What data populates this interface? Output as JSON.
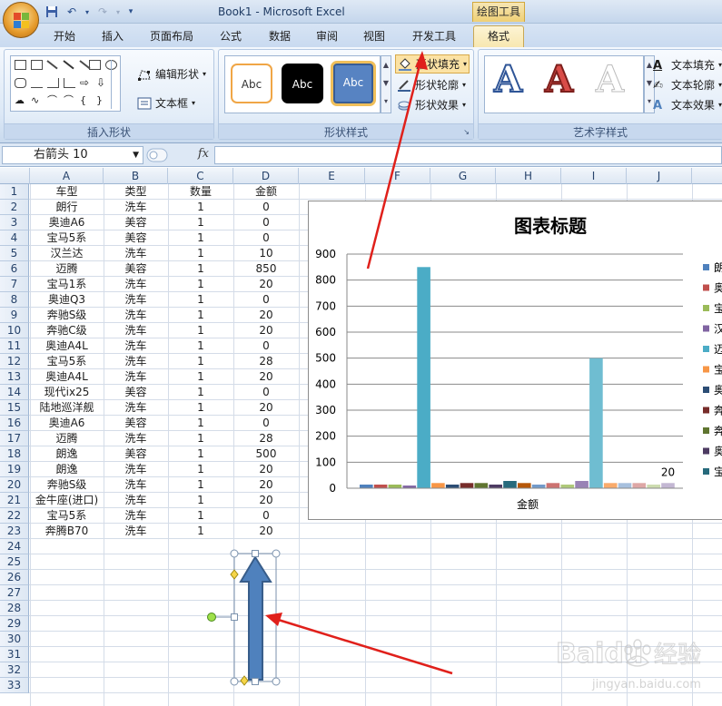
{
  "window": {
    "title": "Book1 - Microsoft Excel",
    "context_tool_title": "绘图工具"
  },
  "tabs": [
    "开始",
    "插入",
    "页面布局",
    "公式",
    "数据",
    "审阅",
    "视图",
    "开发工具",
    "格式"
  ],
  "active_tab": "格式",
  "ribbon": {
    "insert_shapes": {
      "label": "插入形状",
      "edit_shape": "编辑形状",
      "text_box": "文本框"
    },
    "shape_styles": {
      "label": "形状样式",
      "presets": [
        "Abc",
        "Abc",
        "Abc"
      ],
      "fill": "形状填充",
      "outline": "形状轮廓",
      "effects": "形状效果"
    },
    "wordart_styles": {
      "label": "艺术字样式",
      "samples": [
        "A",
        "A",
        "A"
      ],
      "text_fill": "文本填充",
      "text_outline": "文本轮廓",
      "text_effects": "文本效果"
    }
  },
  "formula_bar": {
    "name_box": "右箭头 10",
    "fx": "fx",
    "value": ""
  },
  "sheet": {
    "columns": [
      "A",
      "B",
      "C",
      "D",
      "E",
      "F",
      "G",
      "H",
      "I",
      "J"
    ],
    "row_numbers": [
      "1",
      "2",
      "3",
      "4",
      "5",
      "6",
      "7",
      "8",
      "9",
      "10",
      "11",
      "12",
      "13",
      "14",
      "15",
      "16",
      "17",
      "18",
      "19",
      "20",
      "21",
      "22",
      "23",
      "24",
      "25",
      "26",
      "27",
      "28",
      "29",
      "30",
      "31",
      "32",
      "33"
    ],
    "rows": [
      [
        "车型",
        "类型",
        "数量",
        "金额"
      ],
      [
        "朗行",
        "洗车",
        "1",
        "0"
      ],
      [
        "奥迪A6",
        "美容",
        "1",
        "0"
      ],
      [
        "宝马5系",
        "美容",
        "1",
        "0"
      ],
      [
        "汉兰达",
        "洗车",
        "1",
        "10"
      ],
      [
        "迈腾",
        "美容",
        "1",
        "850"
      ],
      [
        "宝马1系",
        "洗车",
        "1",
        "20"
      ],
      [
        "奥迪Q3",
        "洗车",
        "1",
        "0"
      ],
      [
        "奔驰S级",
        "洗车",
        "1",
        "20"
      ],
      [
        "奔驰C级",
        "洗车",
        "1",
        "20"
      ],
      [
        "奥迪A4L",
        "洗车",
        "1",
        "0"
      ],
      [
        "宝马5系",
        "洗车",
        "1",
        "28"
      ],
      [
        "奥迪A4L",
        "洗车",
        "1",
        "20"
      ],
      [
        "现代ix25",
        "美容",
        "1",
        "0"
      ],
      [
        "陆地巡洋舰",
        "洗车",
        "1",
        "20"
      ],
      [
        "奥迪A6",
        "美容",
        "1",
        "0"
      ],
      [
        "迈腾",
        "洗车",
        "1",
        "28"
      ],
      [
        "朗逸",
        "美容",
        "1",
        "500"
      ],
      [
        "朗逸",
        "洗车",
        "1",
        "20"
      ],
      [
        "奔驰S级",
        "洗车",
        "1",
        "20"
      ],
      [
        "金牛座(进口)",
        "洗车",
        "1",
        "20"
      ],
      [
        "宝马5系",
        "洗车",
        "1",
        "0"
      ],
      [
        "奔腾B70",
        "洗车",
        "1",
        "20"
      ]
    ]
  },
  "chart_data": {
    "type": "bar",
    "title": "图表标题",
    "categories": [
      "金额"
    ],
    "ylim": [
      0,
      900
    ],
    "yticks": [
      0,
      100,
      200,
      300,
      400,
      500,
      600,
      700,
      800,
      900
    ],
    "grid": true,
    "legend_position": "right",
    "series": [
      {
        "name": "朗",
        "values": [
          0
        ],
        "color": "#4f81bd"
      },
      {
        "name": "奥",
        "values": [
          0
        ],
        "color": "#c0504d"
      },
      {
        "name": "宝",
        "values": [
          0
        ],
        "color": "#9bbb59"
      },
      {
        "name": "汉",
        "values": [
          10
        ],
        "color": "#8064a2"
      },
      {
        "name": "迈",
        "values": [
          850
        ],
        "color": "#4bacc6"
      },
      {
        "name": "宝",
        "values": [
          20
        ],
        "color": "#f79646"
      },
      {
        "name": "奥",
        "values": [
          0
        ],
        "color": "#2c4d75"
      },
      {
        "name": "奔",
        "values": [
          20
        ],
        "color": "#772c2a"
      },
      {
        "name": "奔",
        "values": [
          20
        ],
        "color": "#5f7530"
      },
      {
        "name": "奥",
        "values": [
          0
        ],
        "color": "#4d3b62"
      },
      {
        "name": "宝",
        "values": [
          28
        ],
        "color": "#276a7c"
      },
      {
        "name": "",
        "values": [
          20
        ],
        "color": "#b65708"
      },
      {
        "name": "",
        "values": [
          0
        ],
        "color": "#729aca"
      },
      {
        "name": "",
        "values": [
          20
        ],
        "color": "#cd7371"
      },
      {
        "name": "",
        "values": [
          0
        ],
        "color": "#afc97a"
      },
      {
        "name": "",
        "values": [
          28
        ],
        "color": "#9983b5"
      },
      {
        "name": "",
        "values": [
          500
        ],
        "color": "#6fbdd1"
      },
      {
        "name": "",
        "values": [
          20
        ],
        "color": "#f9ab6b"
      },
      {
        "name": "",
        "values": [
          20
        ],
        "color": "#a7c0de"
      },
      {
        "name": "",
        "values": [
          20
        ],
        "color": "#dea7a6"
      },
      {
        "name": "",
        "values": [
          0
        ],
        "color": "#cddcb0"
      },
      {
        "name": "",
        "values": [
          20
        ],
        "color": "#c3b7d3"
      }
    ],
    "data_labels": [
      {
        "series_index": 21,
        "text": "20"
      }
    ]
  },
  "watermark": {
    "brand": "Baidu",
    "suffix": "经验",
    "url": "jingyan.baidu.com"
  }
}
